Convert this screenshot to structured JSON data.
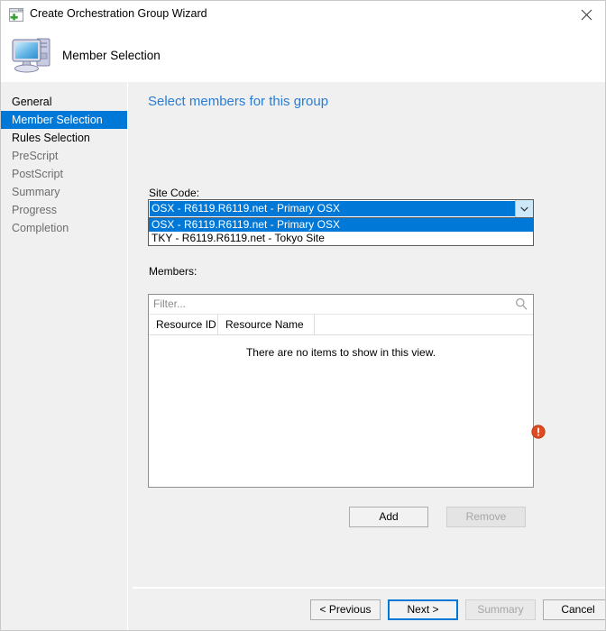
{
  "window": {
    "title": "Create Orchestration Group Wizard",
    "app_icon": "window-plus-icon",
    "close_label": "✕"
  },
  "header": {
    "title": "Member Selection",
    "icon": "computer-icon"
  },
  "sidebar": {
    "items": [
      {
        "label": "General",
        "state": "enabled"
      },
      {
        "label": "Member Selection",
        "state": "selected"
      },
      {
        "label": "Rules Selection",
        "state": "enabled"
      },
      {
        "label": "PreScript",
        "state": "disabled"
      },
      {
        "label": "PostScript",
        "state": "disabled"
      },
      {
        "label": "Summary",
        "state": "disabled"
      },
      {
        "label": "Progress",
        "state": "disabled"
      },
      {
        "label": "Completion",
        "state": "disabled"
      }
    ]
  },
  "main": {
    "heading": "Select members for this group",
    "site_code": {
      "label": "Site Code:",
      "selected": "OSX - R6119.R6119.net - Primary OSX",
      "expanded": true,
      "options": [
        {
          "label": "OSX - R6119.R6119.net - Primary OSX",
          "highlighted": true
        },
        {
          "label": "TKY - R6119.R6119.net - Tokyo Site",
          "highlighted": false
        }
      ]
    },
    "members": {
      "label": "Members:",
      "filter_placeholder": "Filter...",
      "filter_value": "",
      "search_icon": "search-icon",
      "columns": [
        "Resource ID",
        "Resource Name"
      ],
      "rows": [],
      "empty_message": "There are no items to show in this view.",
      "error_icon": "error-exclamation-icon"
    },
    "actions": {
      "add": {
        "label": "Add",
        "enabled": true
      },
      "remove": {
        "label": "Remove",
        "enabled": false
      }
    }
  },
  "footer": {
    "previous": {
      "label": "< Previous",
      "enabled": true,
      "default": false
    },
    "next": {
      "label": "Next >",
      "enabled": true,
      "default": true
    },
    "summary": {
      "label": "Summary",
      "enabled": false,
      "default": false
    },
    "cancel": {
      "label": "Cancel",
      "enabled": true,
      "default": false
    }
  },
  "colors": {
    "accent": "#0078d7",
    "heading": "#2b7cd3",
    "panel": "#f0f0f0",
    "error": "#e04a23"
  }
}
